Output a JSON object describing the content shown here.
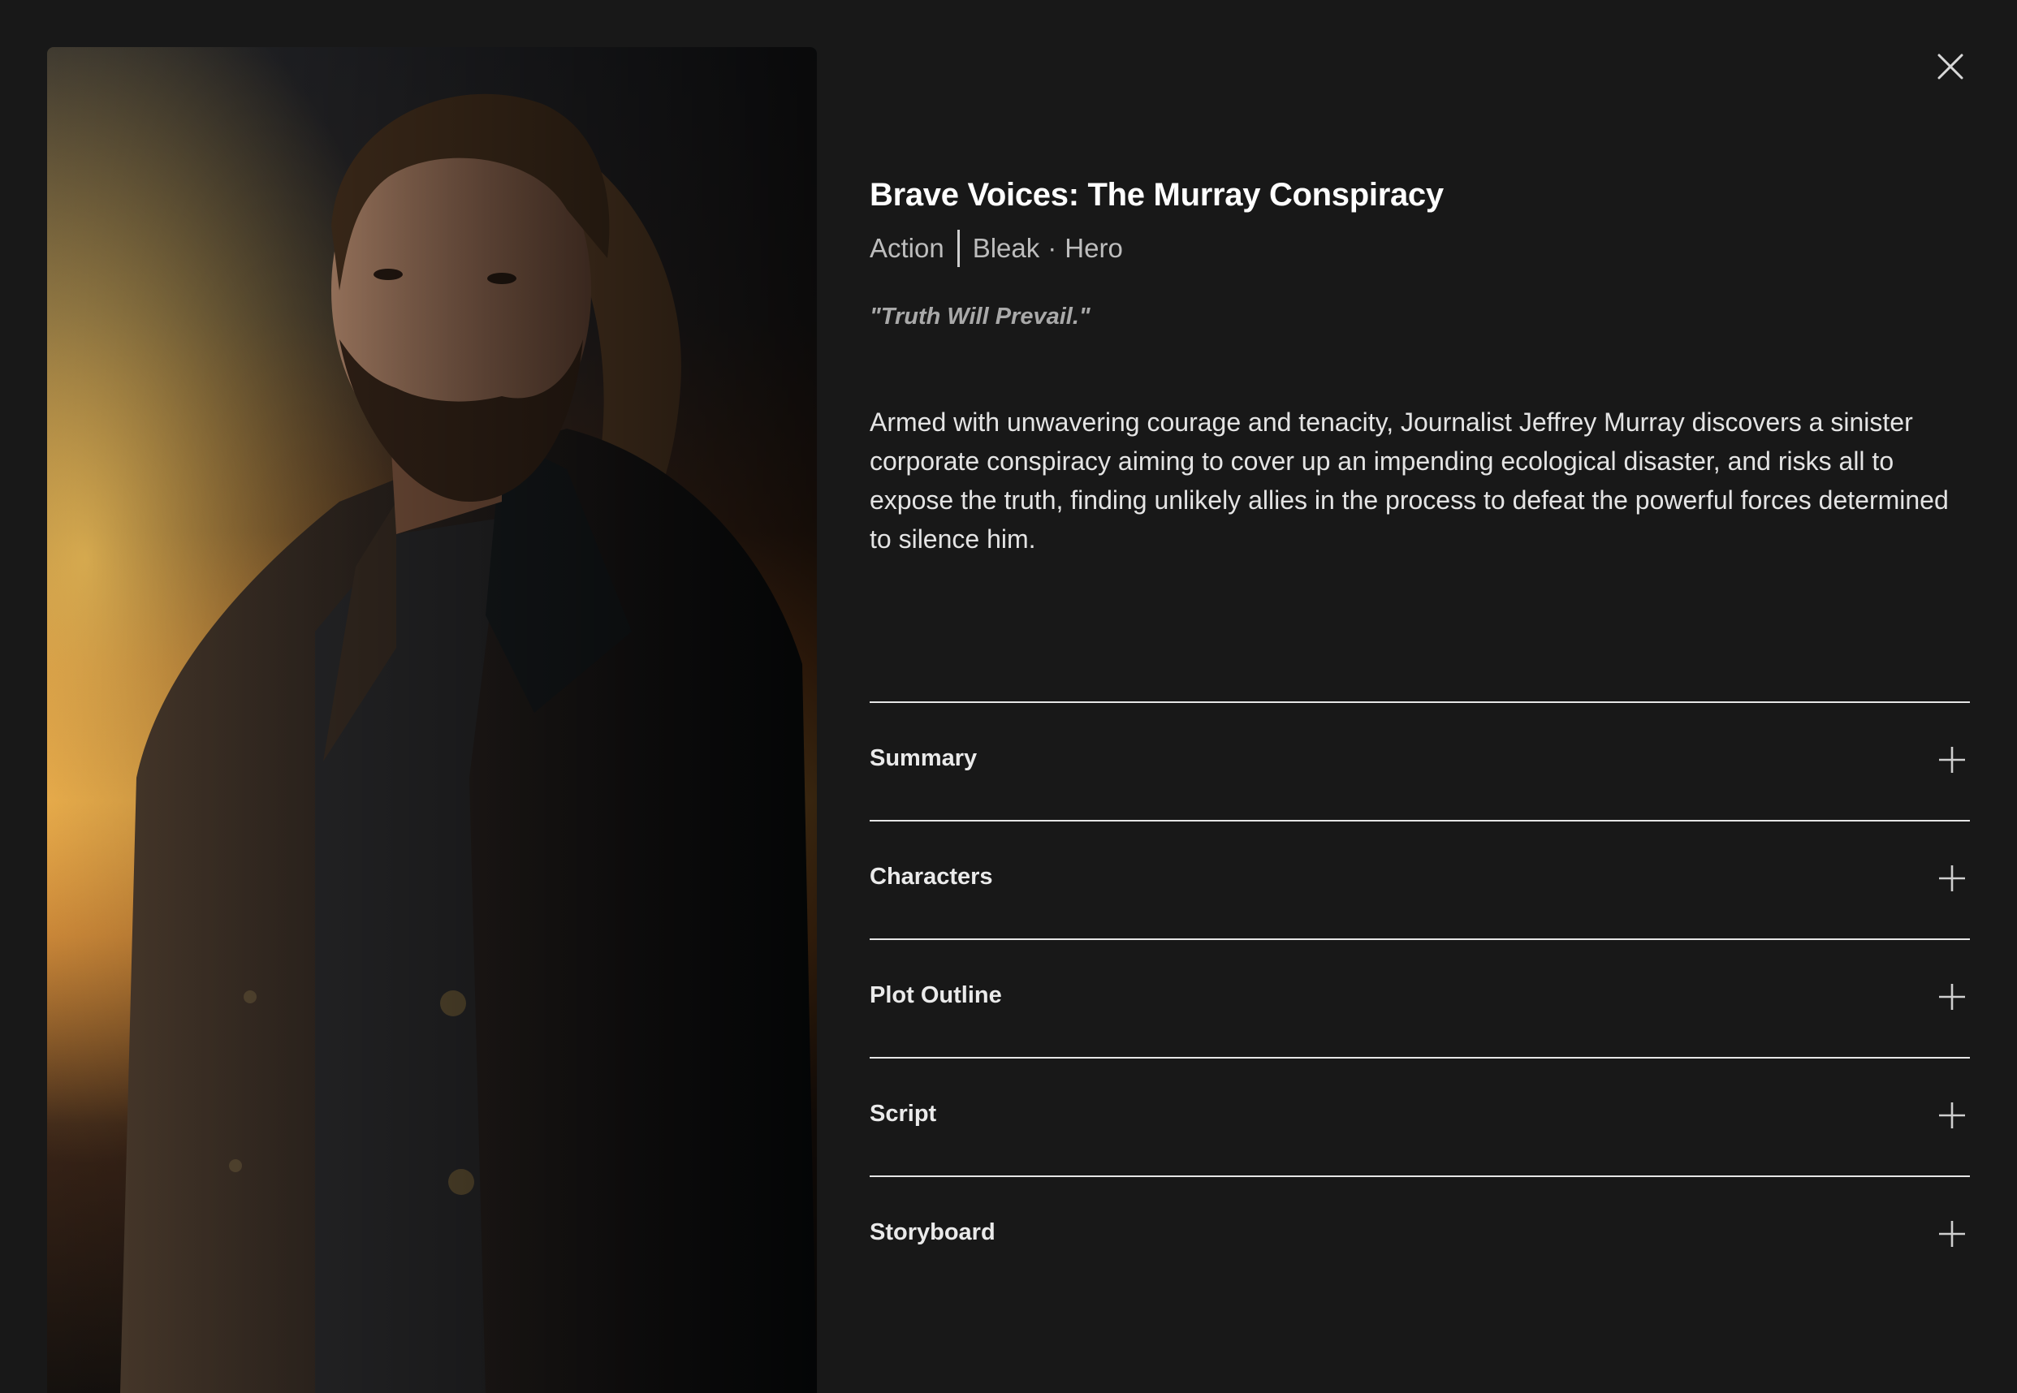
{
  "story": {
    "title": "Brave Voices: The Murray Conspiracy",
    "genre": "Action",
    "tone": "Bleak",
    "archetype": "Hero",
    "meta_dot": "·",
    "tagline": "\"Truth Will Prevail.\"",
    "description": "Armed with unwavering courage and tenacity, Journalist Jeffrey Murray discovers a sinister corporate conspiracy aiming to cover up an impending ecological disaster, and risks all to expose the truth, finding unlikely allies in the process to defeat the powerful forces determined to silence him."
  },
  "poster": {
    "icon": "portrait-image"
  },
  "close": {
    "icon": "close-icon"
  },
  "sections": [
    {
      "label": "Summary",
      "icon": "plus-icon"
    },
    {
      "label": "Characters",
      "icon": "plus-icon"
    },
    {
      "label": "Plot Outline",
      "icon": "plus-icon"
    },
    {
      "label": "Script",
      "icon": "plus-icon"
    },
    {
      "label": "Storyboard",
      "icon": "plus-icon"
    }
  ],
  "colors": {
    "background": "#181818",
    "text_primary": "#ffffff",
    "text_secondary": "#bdbdbd",
    "divider": "#e6e6e6"
  }
}
